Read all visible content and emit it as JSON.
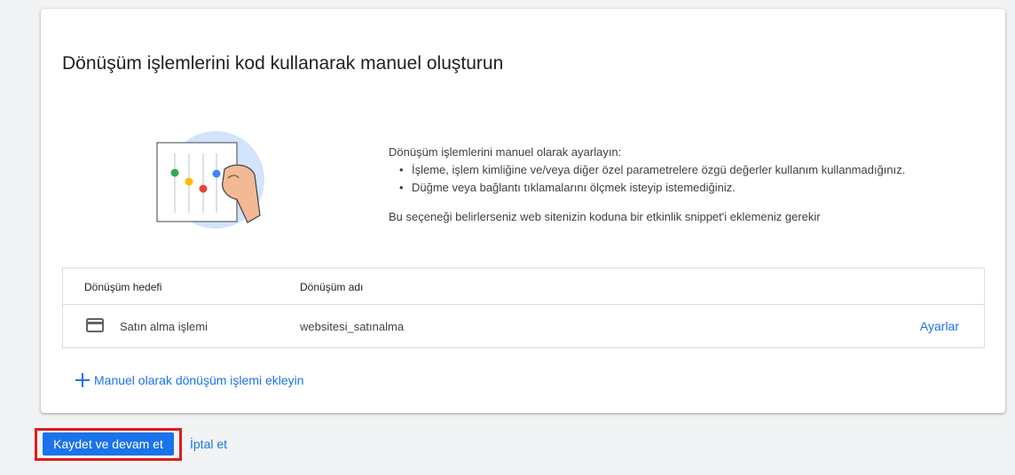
{
  "card": {
    "title": "Dönüşüm işlemlerini kod kullanarak manuel oluşturun"
  },
  "description": {
    "intro": "Dönüşüm işlemlerini manuel olarak ayarlayın:",
    "bullets": [
      "İşleme, işlem kimliğine ve/veya diğer özel parametrelere özgü değerler kullanım kullanmadığınız.",
      "Düğme veya bağlantı tıklamalarını ölçmek isteyip istemediğiniz."
    ],
    "note": "Bu seçeneği belirlerseniz web sitenizin koduna bir etkinlik snippet'i eklemeniz gerekir"
  },
  "table": {
    "headers": {
      "goal": "Dönüşüm hedefi",
      "name": "Dönüşüm adı"
    },
    "rows": [
      {
        "goal": "Satın alma işlemi",
        "name": "websitesi_satınalma",
        "action": "Ayarlar",
        "icon": "credit-card-icon"
      }
    ]
  },
  "add_link": {
    "label": "Manuel olarak dönüşüm işlemi ekleyin",
    "icon": "plus-icon"
  },
  "footer": {
    "save_label": "Kaydet ve devam et",
    "cancel_label": "İptal et"
  },
  "colors": {
    "accent": "#1a73e8",
    "highlight": "#e01b1b"
  }
}
